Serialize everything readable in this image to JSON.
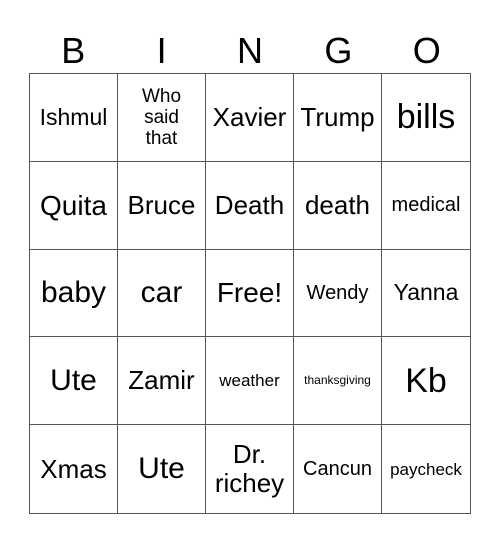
{
  "title_letters": [
    "B",
    "I",
    "N",
    "G",
    "O"
  ],
  "cells": [
    {
      "text": "Ishmul"
    },
    {
      "text": "Who\nsaid\nthat"
    },
    {
      "text": "Xavier"
    },
    {
      "text": "Trump"
    },
    {
      "text": "bills"
    },
    {
      "text": "Quita"
    },
    {
      "text": "Bruce"
    },
    {
      "text": "Death"
    },
    {
      "text": "death"
    },
    {
      "text": "medical"
    },
    {
      "text": "baby"
    },
    {
      "text": "car"
    },
    {
      "text": "Free!"
    },
    {
      "text": "Wendy"
    },
    {
      "text": "Yanna"
    },
    {
      "text": "Ute"
    },
    {
      "text": "Zamir"
    },
    {
      "text": "weather"
    },
    {
      "text": "thanksgiving"
    },
    {
      "text": "Kb"
    },
    {
      "text": "Xmas"
    },
    {
      "text": "Ute"
    },
    {
      "text": "Dr.\nrichey"
    },
    {
      "text": "Cancun"
    },
    {
      "text": "paycheck"
    }
  ]
}
